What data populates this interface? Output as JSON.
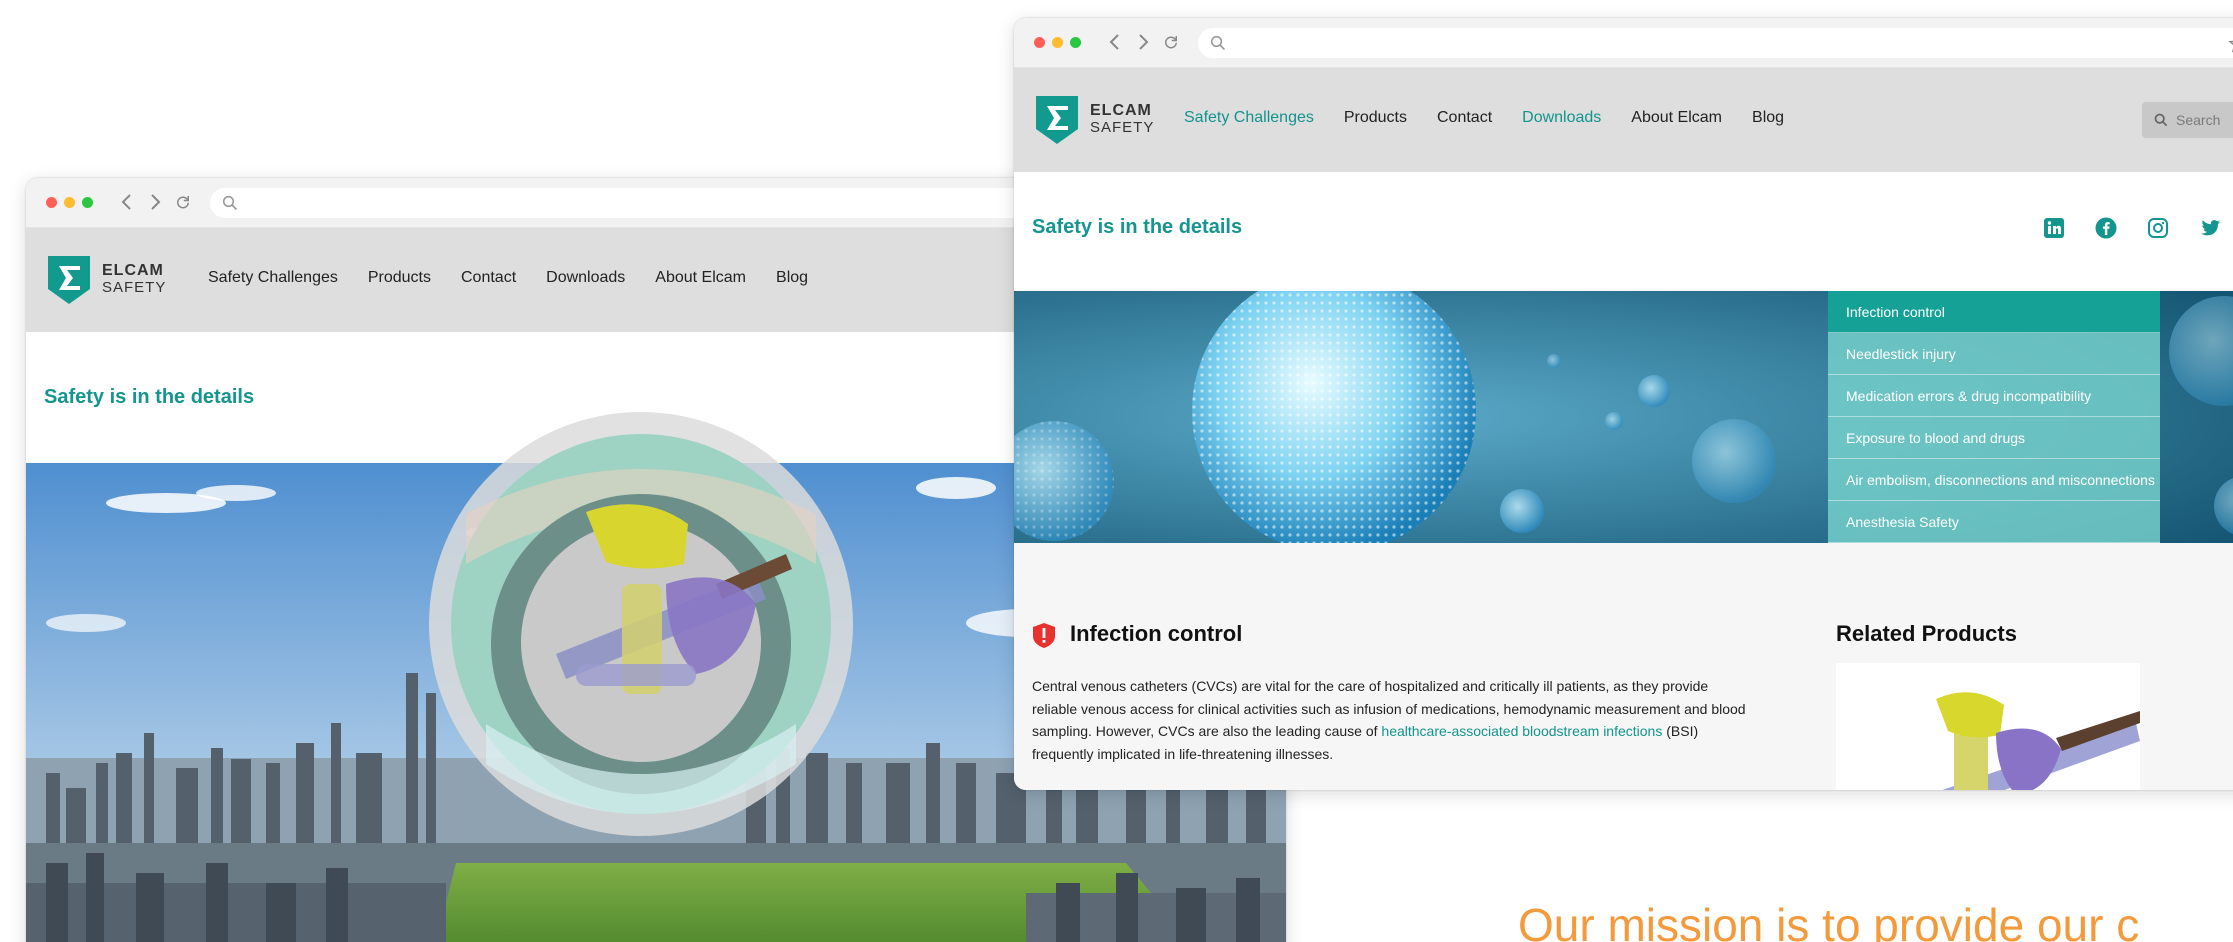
{
  "back_window": {
    "logo": {
      "line1": "ELCAM",
      "line2": "SAFETY"
    },
    "nav": [
      "Safety Challenges",
      "Products",
      "Contact",
      "Downloads",
      "About Elcam",
      "Blog"
    ],
    "tagline": "Safety is in the details"
  },
  "front_window": {
    "logo": {
      "line1": "ELCAM",
      "line2": "SAFETY"
    },
    "nav": [
      "Safety Challenges",
      "Products",
      "Contact",
      "Downloads",
      "About Elcam",
      "Blog"
    ],
    "active_nav": [
      "Safety Challenges",
      "Downloads"
    ],
    "search_placeholder": "Search",
    "tagline": "Safety is in the details",
    "social_icons": [
      "linkedin-icon",
      "facebook-icon",
      "instagram-icon",
      "twitter-icon",
      "youtube-icon"
    ],
    "safety_menu": {
      "items": [
        "Infection control",
        "Needlestick injury",
        "Medication errors & drug incompatibility",
        "Exposure to blood and drugs",
        "Air embolism, disconnections and misconnections",
        "Anesthesia Safety"
      ],
      "active": "Infection control"
    },
    "section": {
      "title": "Infection control",
      "text_before_link": "Central venous catheters (CVCs) are vital for the care of hospitalized and critically ill patients, as they provide reliable venous access for clinical activities such as infusion of medications, hemodynamic measurement and blood sampling. However, CVCs are also the leading cause of ",
      "link": "healthcare-associated bloodstream infections",
      "text_after_link": " (BSI) frequently implicated in life-threatening illnesses."
    },
    "related_title": "Related Products"
  },
  "mission_text": "Our mission is to provide our c",
  "colors": {
    "teal": "#14958d",
    "teal_active": "#16a197",
    "teal_light": "#78d2cc",
    "nav_bg": "#dedede",
    "orange": "#f39a3d"
  }
}
